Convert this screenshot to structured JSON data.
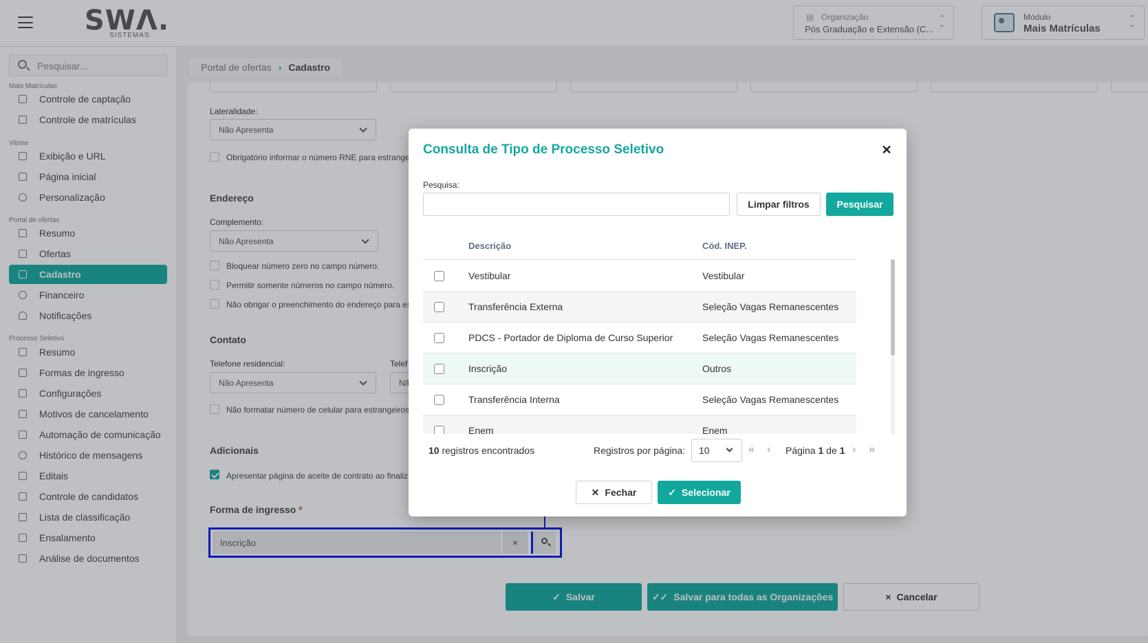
{
  "header": {
    "logo_text": "SWΛ.",
    "logo_sub": "SISTEMAS",
    "organization_label": "Organização",
    "organization_value": "Pós Graduação e Extensão (C...",
    "module_label": "Módulo",
    "module_value": "Mais Matrículas"
  },
  "sidebar": {
    "search_placeholder": "Pesquisar...",
    "groups": [
      "Mais Matrículas",
      "Vitrine",
      "Portal de ofertas",
      "Processo Seletivo"
    ],
    "items": [
      "Controle de captação",
      "Controle de matrículas",
      "Exibição e URL",
      "Página inicial",
      "Personalização",
      "Resumo",
      "Ofertas",
      "Cadastro",
      "Financeiro",
      "Notificações",
      "Resumo",
      "Formas de ingresso",
      "Configurações",
      "Motivos de cancelamento",
      "Automação de comunicação",
      "Histórico de mensagens",
      "Editais",
      "Controle de candidatos",
      "Lista de classificação",
      "Ensalamento",
      "Análise de documentos"
    ]
  },
  "breadcrumb": {
    "parent": "Portal de ofertas",
    "current": "Cadastro"
  },
  "form": {
    "lateralidade_label": "Lateralidade:",
    "lateralidade_value": "Não Apresenta",
    "rne_check": "Obrigatório informar o número RNE para estrange",
    "endereco_title": "Endereço",
    "complemento_label": "Complemento:",
    "complemento_value": "Não Apresenta",
    "chk_zero": "Bloquear número zero no campo número.",
    "chk_numeros": "Permitir somente números no campo número.",
    "chk_endereco": "Não obrigar o preenchimento do endereço para es",
    "contato_title": "Contato",
    "telres_label": "Telefone residencial:",
    "telres_value": "Não Apresenta",
    "telef2_label": "Telef",
    "telef2_value": "Nã",
    "chk_celular": "Não formatar número de celular para estrangeiros",
    "adicionais_title": "Adicionais",
    "chk_contrato": "Apresentar página de aceite de contrato ao finaliz",
    "forma_title": "Forma de ingresso",
    "forma_req": "*",
    "forma_value": "Inscrição",
    "btn_salvar": "Salvar",
    "btn_salvar_todas": "Salvar para todas as Organizações",
    "btn_cancelar": "Cancelar"
  },
  "modal": {
    "title": "Consulta de Tipo de Processo Seletivo",
    "search_label": "Pesquisa:",
    "search_value": "",
    "btn_clear": "Limpar filtros",
    "btn_search": "Pesquisar",
    "col_desc": "Descrição",
    "col_inep": "Cód. INEP.",
    "rows": [
      {
        "desc": "Vestibular",
        "inep": "Vestibular"
      },
      {
        "desc": "Transferência Externa",
        "inep": "Seleção Vagas Remanescentes"
      },
      {
        "desc": "PDCS - Portador de Diploma de Curso Superior",
        "inep": "Seleção Vagas Remanescentes"
      },
      {
        "desc": "Inscrição",
        "inep": "Outros"
      },
      {
        "desc": "Transferência Interna",
        "inep": "Seleção Vagas Remanescentes"
      },
      {
        "desc": "Enem",
        "inep": "Enem"
      }
    ],
    "count_number": "10",
    "count_text": "registros encontrados",
    "rpp_label": "Registros por página:",
    "rpp_value": "10",
    "page_prefix": "Página",
    "page_current": "1",
    "page_of": "de",
    "page_total": "1",
    "btn_close": "Fechar",
    "btn_select": "Selecionar"
  }
}
